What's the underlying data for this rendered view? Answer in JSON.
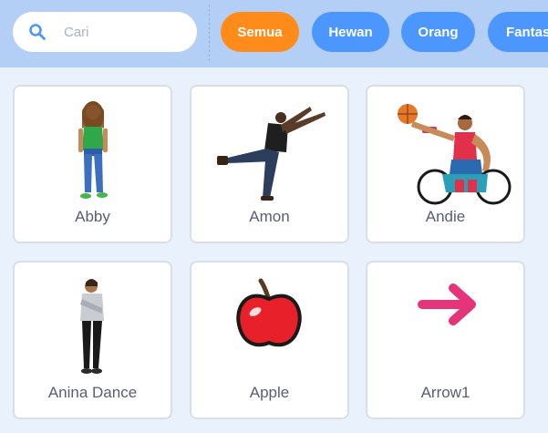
{
  "search": {
    "placeholder": "Cari",
    "icon": "search-icon"
  },
  "filters": [
    {
      "label": "Semua",
      "selected": true
    },
    {
      "label": "Hewan",
      "selected": false
    },
    {
      "label": "Orang",
      "selected": false
    },
    {
      "label": "Fantasi",
      "selected": false
    }
  ],
  "sprites": [
    {
      "name": "Abby",
      "icon": "girl-figure"
    },
    {
      "name": "Amon",
      "icon": "dancer-figure"
    },
    {
      "name": "Andie",
      "icon": "wheelchair-basketball-figure"
    },
    {
      "name": "Anina Dance",
      "icon": "dancer-figure"
    },
    {
      "name": "Apple",
      "icon": "apple-icon"
    },
    {
      "name": "Arrow1",
      "icon": "arrow-right-icon"
    }
  ],
  "colors": {
    "header_bg": "#b4cff6",
    "page_bg": "#e9f1fc",
    "pill_blue": "#4c97ff",
    "pill_selected": "#ff8c1a",
    "arrow": "#e6347a",
    "apple": "#e8202a"
  }
}
